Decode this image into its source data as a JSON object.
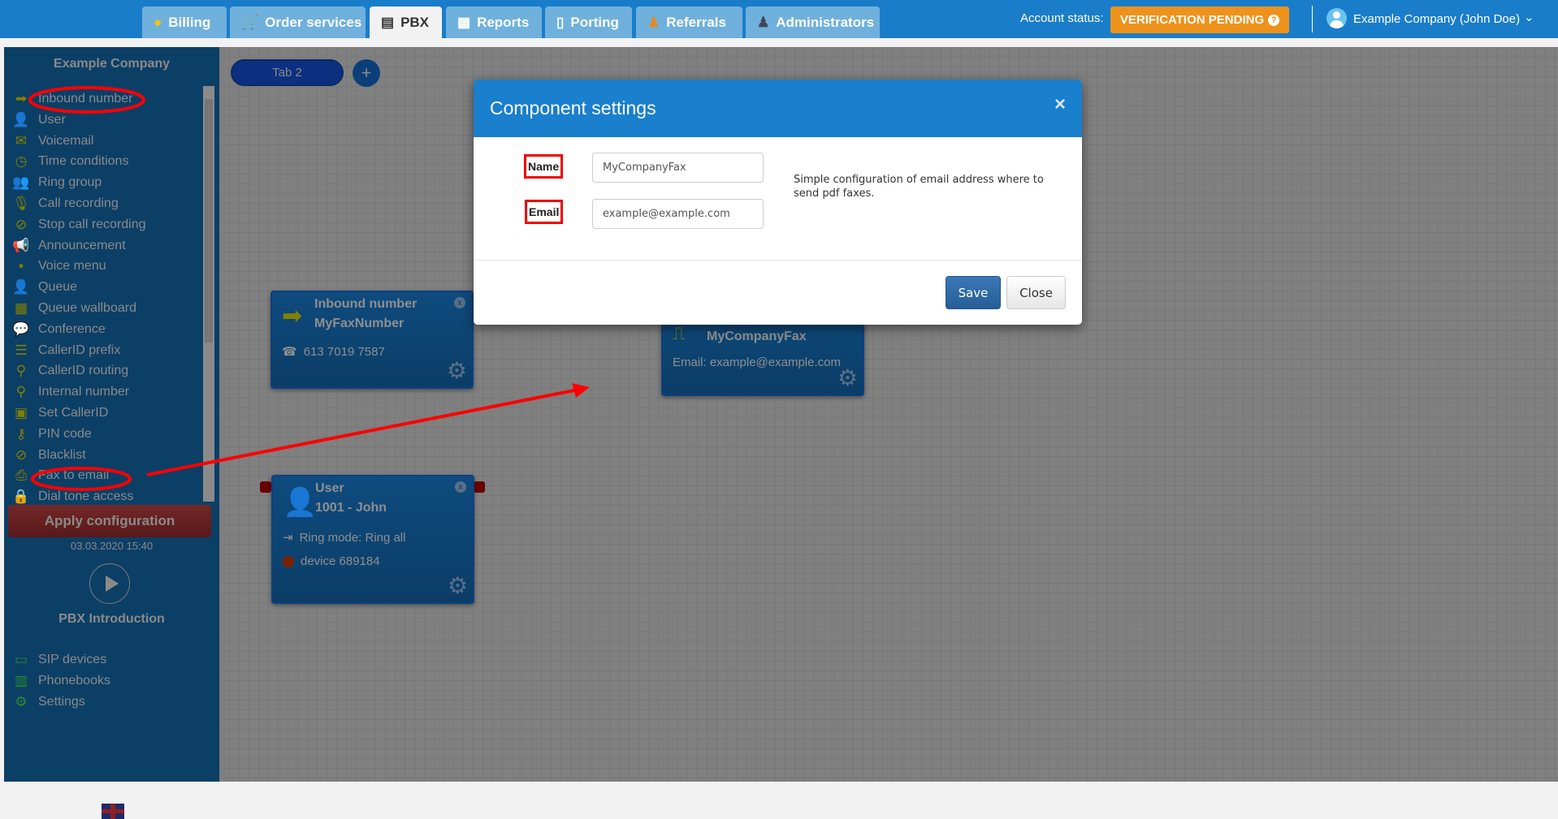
{
  "topbar": {
    "tabs": [
      {
        "label": "Billing",
        "icon": "coins-icon"
      },
      {
        "label": "Order services",
        "icon": "cart-icon"
      },
      {
        "label": "PBX",
        "icon": "pbx-icon",
        "active": true
      },
      {
        "label": "Reports",
        "icon": "report-icon"
      },
      {
        "label": "Porting",
        "icon": "phone-icon"
      },
      {
        "label": "Referrals",
        "icon": "person-icon"
      },
      {
        "label": "Administrators",
        "icon": "admin-icon"
      }
    ],
    "account_status_label": "Account status:",
    "account_status": "VERIFICATION PENDING",
    "user": "Example Company (John Doe)"
  },
  "sidebar": {
    "company": "Example Company",
    "components": [
      "Inbound number",
      "User",
      "Voicemail",
      "Time conditions",
      "Ring group",
      "Call recording",
      "Stop call recording",
      "Announcement",
      "Voice menu",
      "Queue",
      "Queue wallboard",
      "Conference",
      "CallerID prefix",
      "CallerID routing",
      "Internal number",
      "Set CallerID",
      "PIN code",
      "Blacklist",
      "Fax to email",
      "Dial tone access"
    ],
    "apply_label": "Apply configuration",
    "applied_at": "03.03.2020 15:40",
    "intro_label": "PBX Introduction",
    "bottom": [
      "SIP devices",
      "Phonebooks",
      "Settings"
    ]
  },
  "canvas": {
    "tab": "Tab 2",
    "add_tab": "+",
    "nodes": {
      "inbound": {
        "type": "Inbound number",
        "name": "MyFaxNumber",
        "number": "613 7019 7587"
      },
      "fax": {
        "name": "MyCompanyFax",
        "email": "Email: example@example.com"
      },
      "user": {
        "type": "User",
        "name": "1001 - John",
        "ring_mode": "Ring mode: Ring all",
        "device": "device 689184"
      }
    }
  },
  "modal": {
    "title": "Component settings",
    "name_label": "Name",
    "name_value": "MyCompanyFax",
    "email_label": "Email",
    "email_value": "example@example.com",
    "description": "Simple configuration of email address where to send pdf faxes.",
    "save": "Save",
    "close": "Close"
  },
  "colors": {
    "topbar": "#1a7dca",
    "badge": "#ee921c",
    "annotation": "#ff0000",
    "modal_header": "#1a7fcc"
  }
}
